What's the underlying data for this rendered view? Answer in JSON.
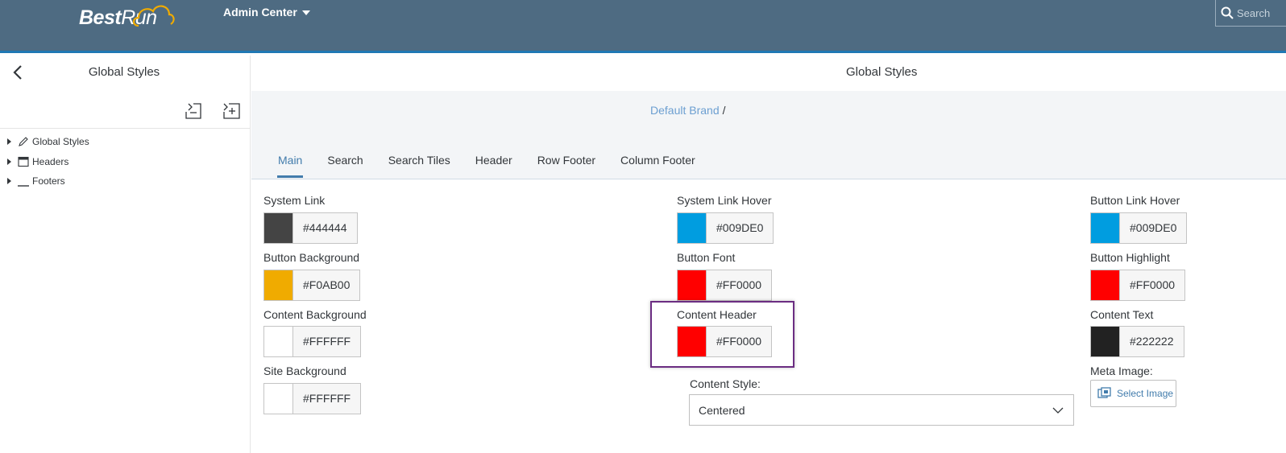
{
  "shell": {
    "logo_part1": "Best",
    "logo_part2": "Run",
    "app_title": "Admin Center",
    "search_placeholder": "Search"
  },
  "left_panel": {
    "title": "Global Styles",
    "tree": [
      {
        "label": "Global Styles",
        "icon": "pencil-icon"
      },
      {
        "label": "Headers",
        "icon": "header-window-icon"
      },
      {
        "label": "Footers",
        "icon": "footer-line-icon"
      }
    ]
  },
  "main": {
    "title": "Global Styles",
    "breadcrumb": {
      "link": "Default Brand",
      "separator": "/"
    },
    "tabs": [
      "Main",
      "Search",
      "Search Tiles",
      "Header",
      "Row Footer",
      "Column Footer"
    ],
    "active_tab": "Main",
    "colors": {
      "system_link": {
        "label": "System Link",
        "value": "#444444"
      },
      "system_link_hover": {
        "label": "System Link Hover",
        "value": "#009DE0"
      },
      "button_link_hover": {
        "label": "Button Link Hover",
        "value": "#009DE0"
      },
      "button_background": {
        "label": "Button Background",
        "value": "#F0AB00"
      },
      "button_font": {
        "label": "Button Font",
        "value": "#FF0000"
      },
      "button_highlight": {
        "label": "Button Highlight",
        "value": "#FF0000"
      },
      "content_background": {
        "label": "Content Background",
        "value": "#FFFFFF"
      },
      "content_header": {
        "label": "Content Header",
        "value": "#FF0000"
      },
      "content_text": {
        "label": "Content Text",
        "value": "#222222"
      },
      "site_background": {
        "label": "Site Background",
        "value": "#FFFFFF"
      }
    },
    "content_style": {
      "label": "Content Style:",
      "value": "Centered"
    },
    "meta_image": {
      "label": "Meta Image:",
      "button": "Select Image"
    }
  },
  "theme": {
    "shell_bg": "#4e6b82",
    "accent": "#427cac",
    "highlight_border": "#6b2d82"
  }
}
